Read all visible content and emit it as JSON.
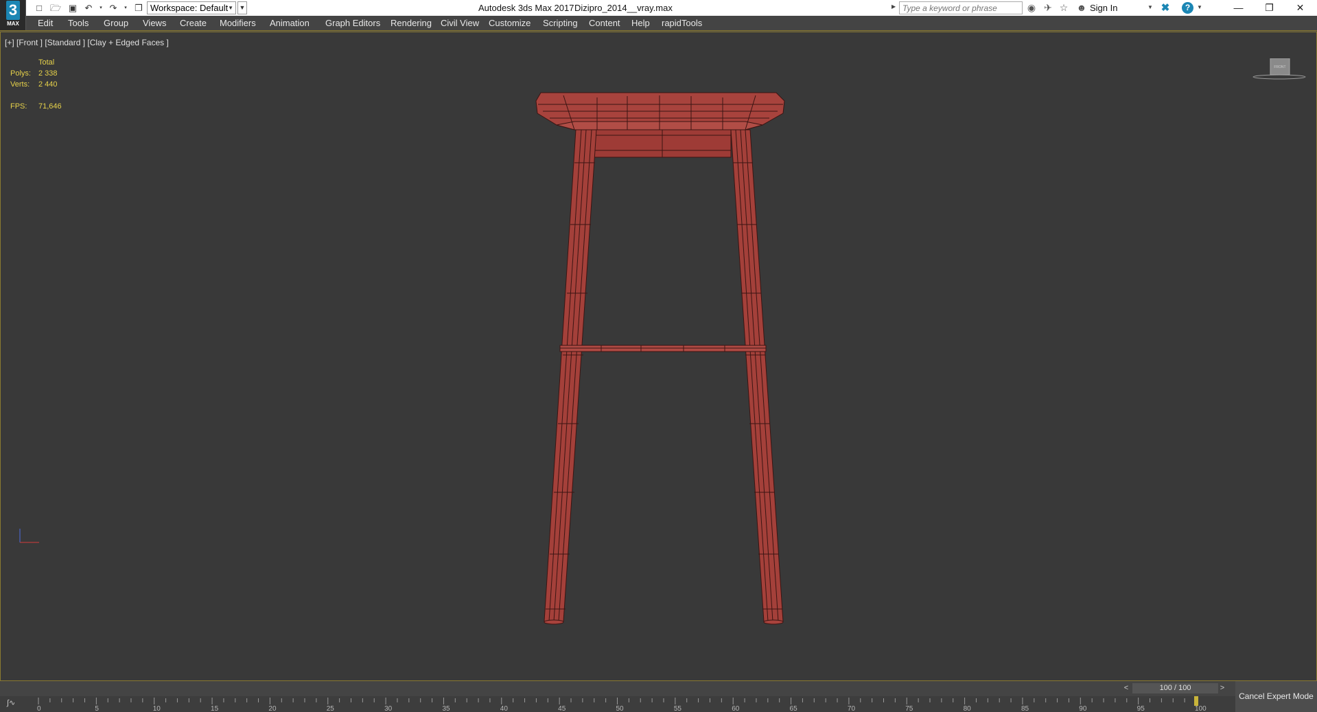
{
  "title_bar": {
    "workspace_label": "Workspace: Default",
    "app_name": "Autodesk 3ds Max 2017",
    "file_name": "Dizipro_2014__vray.max",
    "search_placeholder": "Type a keyword or phrase",
    "sign_in": "Sign In",
    "logo_number": "3",
    "logo_text": "MAX"
  },
  "menu": [
    "Edit",
    "Tools",
    "Group",
    "Views",
    "Create",
    "Modifiers",
    "Animation",
    "Graph Editors",
    "Rendering",
    "Civil View",
    "Customize",
    "Scripting",
    "Content",
    "Help",
    "rapidTools"
  ],
  "viewport": {
    "label": "[+] [Front ] [Standard ] [Clay + Edged Faces ]",
    "stats": {
      "header": "Total",
      "polys_label": "Polys:",
      "polys_value": "2 338",
      "verts_label": "Verts:",
      "verts_value": "2 440",
      "fps_label": "FPS:",
      "fps_value": "71,646"
    },
    "viewcube_label": "FRONT"
  },
  "timeline": {
    "frame_display": "100 / 100",
    "current_frame": 100,
    "ruler_labels": [
      "0",
      "5",
      "10",
      "15",
      "20",
      "25",
      "30",
      "35",
      "40",
      "45",
      "50",
      "55",
      "60",
      "65",
      "70",
      "75",
      "80",
      "85",
      "90",
      "95",
      "100"
    ]
  },
  "cancel_expert_mode": "Cancel Expert Mode",
  "colors": {
    "stool_fill": "#a8433d",
    "stool_edge": "#3a1412",
    "viewport_bg": "#393939",
    "stats_text": "#e7d24a",
    "accent": "#1b86b4"
  }
}
